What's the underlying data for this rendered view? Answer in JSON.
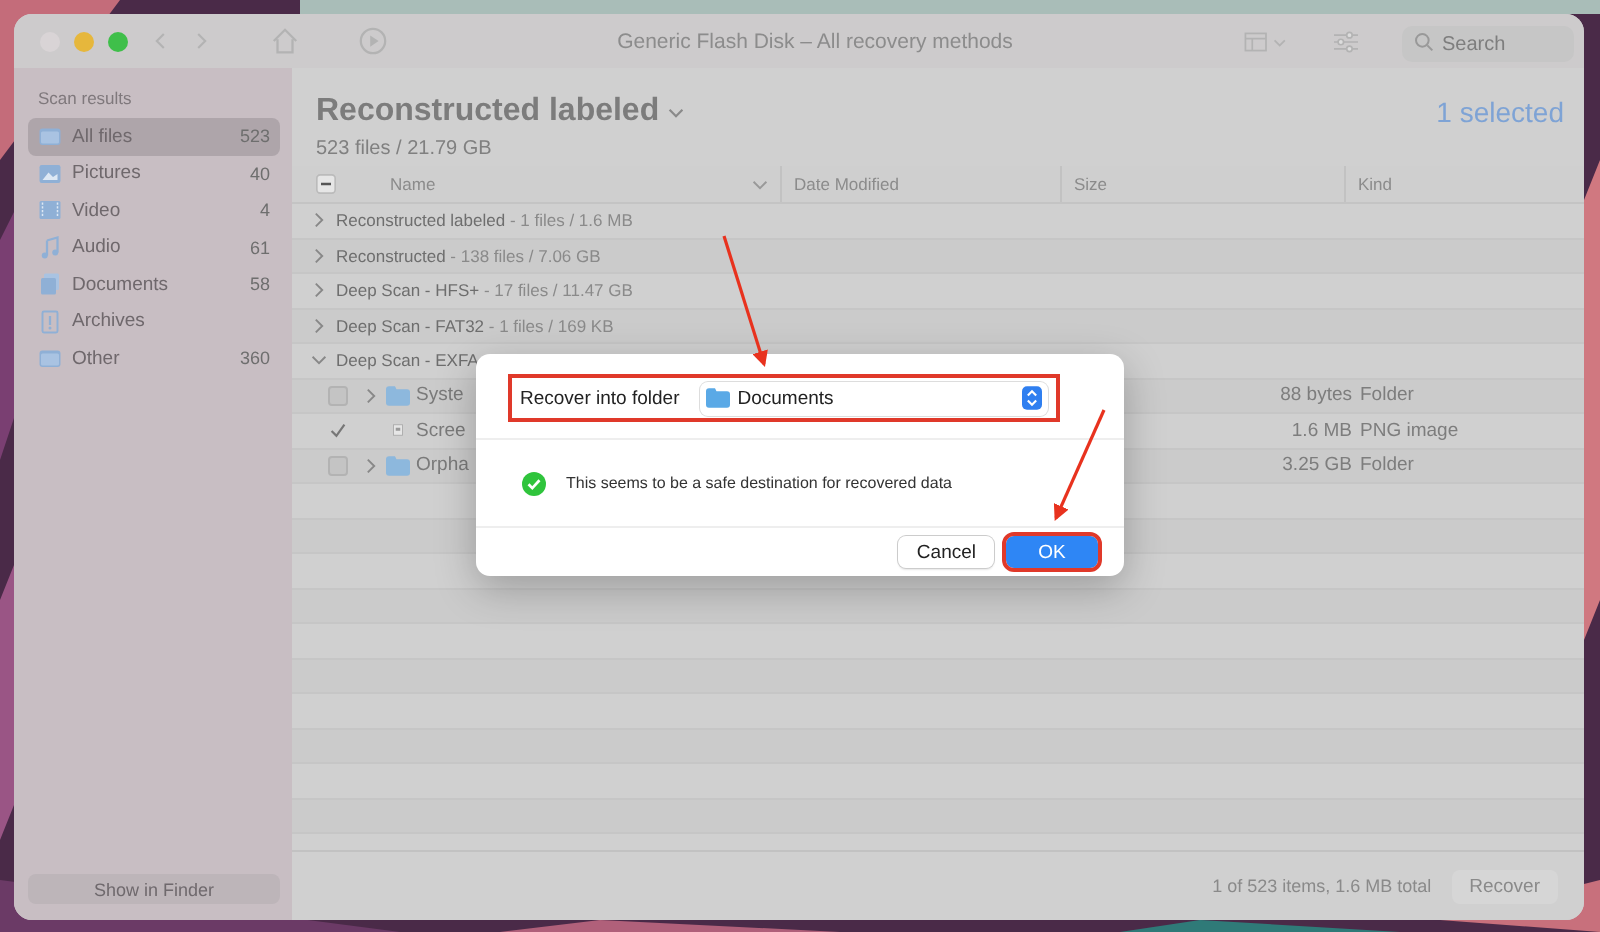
{
  "window": {
    "title": "Generic Flash Disk – All recovery methods"
  },
  "toolbar": {
    "search": {
      "placeholder": "Search"
    }
  },
  "sidebar": {
    "heading": "Scan results",
    "items": [
      {
        "label": "All files",
        "count": "523",
        "selected": true,
        "kind": "files"
      },
      {
        "label": "Pictures",
        "count": "40",
        "selected": false,
        "kind": "pictures"
      },
      {
        "label": "Video",
        "count": "4",
        "selected": false,
        "kind": "video"
      },
      {
        "label": "Audio",
        "count": "61",
        "selected": false,
        "kind": "audio"
      },
      {
        "label": "Documents",
        "count": "58",
        "selected": false,
        "kind": "documents"
      },
      {
        "label": "Archives",
        "selected": false,
        "kind": "archives"
      },
      {
        "label": "Other",
        "count": "360",
        "selected": false,
        "kind": "other"
      }
    ],
    "footer_button": "Show in Finder"
  },
  "main": {
    "title": "Reconstructed labeled",
    "subtitle": "523 files / 21.79 GB",
    "selection": "1 selected",
    "table": {
      "header_checkbox": {
        "mixed": true
      },
      "columns": [
        "Name",
        "Date Modified",
        "Size",
        "Kind"
      ],
      "rows": [
        {
          "kind": "group",
          "name": "Reconstructed labeled",
          "detail": "- 1 files / 1.6 MB",
          "expanded": false
        },
        {
          "kind": "group",
          "name": "Reconstructed",
          "detail": "- 138 files / 7.06 GB",
          "expanded": false
        },
        {
          "kind": "group",
          "name": "Deep Scan - HFS+",
          "detail": "- 17 files / 11.47 GB",
          "expanded": false
        },
        {
          "kind": "group",
          "name": "Deep Scan - FAT32",
          "detail": "- 1 files / 169 KB",
          "expanded": false
        },
        {
          "kind": "group",
          "name": "Deep Scan - EXFA",
          "expanded": true
        },
        {
          "kind": "folder",
          "name": "Syste",
          "size": "88 bytes",
          "type": "Folder",
          "checked": false
        },
        {
          "kind": "file",
          "name": "Scree",
          "size": "1.6 MB",
          "type": "PNG image",
          "checked": true
        },
        {
          "kind": "folder",
          "name": "Orpha",
          "size": "3.25 GB",
          "type": "Folder",
          "checked": false
        }
      ]
    },
    "status": "1 of 523 items, 1.6 MB total",
    "recover_button": "Recover"
  },
  "dialog": {
    "label": "Recover into folder",
    "folder": "Documents",
    "message": "This seems to be a safe destination for recovered data",
    "buttons": [
      "Cancel",
      "OK"
    ]
  }
}
